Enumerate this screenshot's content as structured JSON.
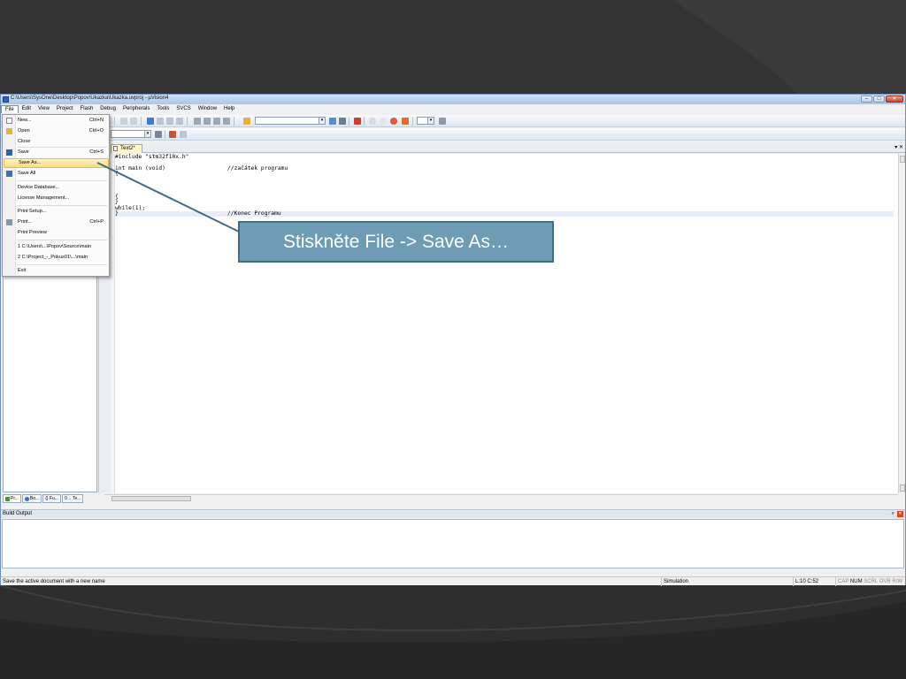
{
  "window": {
    "title": "C:\\Users\\SysOne\\Desktop\\Popov\\Ukazka\\Ukazka.uvproj - µVision4",
    "min_glyph": "–",
    "max_glyph": "□",
    "close_glyph": "✕"
  },
  "menubar": {
    "items": [
      "File",
      "Edit",
      "View",
      "Project",
      "Flash",
      "Debug",
      "Peripherals",
      "Tools",
      "SVCS",
      "Window",
      "Help"
    ]
  },
  "file_menu": {
    "items": [
      {
        "label": "New...",
        "shortcut": "Ctrl+N"
      },
      {
        "label": "Open",
        "shortcut": "Ctrl+O"
      },
      {
        "label": "Close",
        "shortcut": ""
      },
      {
        "label": "Save",
        "shortcut": "Ctrl+S"
      },
      {
        "label": "Save As...",
        "shortcut": ""
      },
      {
        "label": "Save All",
        "shortcut": ""
      },
      {
        "label": "Device Database...",
        "shortcut": ""
      },
      {
        "label": "License Management...",
        "shortcut": ""
      },
      {
        "label": "Print Setup...",
        "shortcut": ""
      },
      {
        "label": "Print...",
        "shortcut": "Ctrl+P"
      },
      {
        "label": "Print Preview",
        "shortcut": ""
      },
      {
        "label": "1 C:\\Users\\...\\Popov\\Source\\main",
        "shortcut": ""
      },
      {
        "label": "2 C:\\Project_-_Pokus01\\...\\main",
        "shortcut": ""
      },
      {
        "label": "Exit",
        "shortcut": ""
      }
    ]
  },
  "editor": {
    "tab_label": "Text2*",
    "tabstrip_controls": "▾ ✕",
    "lines": [
      {
        "code": "#include \"stm32f10x.h\"",
        "comment": ""
      },
      {
        "code": "",
        "comment": ""
      },
      {
        "code": "int main (void)",
        "comment": "//začátek programu"
      },
      {
        "code": "{",
        "comment": ""
      },
      {
        "code": "",
        "comment": ""
      },
      {
        "code": "",
        "comment": ""
      },
      {
        "code": "",
        "comment": ""
      },
      {
        "code": "{",
        "comment": ""
      },
      {
        "code": "}",
        "comment": ""
      },
      {
        "code": "while(1);",
        "comment": ""
      },
      {
        "code": "}",
        "comment": "//Konec Programu"
      }
    ]
  },
  "left_tabs": [
    "Pr...",
    "Bo...",
    "{} Fu...",
    "0→ Te..."
  ],
  "build_output": {
    "title": "Build Output",
    "pin": "⌕",
    "close": "✕"
  },
  "statusbar": {
    "message": "Save the active document with a new name",
    "mode": "Simulation",
    "position": "L:10 C:52",
    "cap": "CAP",
    "num": "NUM",
    "scrl": "SCRL",
    "ovr": "OVR",
    "rw": "R/W"
  },
  "callout": {
    "text": "Stiskněte File -> Save As…"
  },
  "colors": {
    "callout_fill": "#6e9cb4",
    "callout_border": "#3e6d87",
    "slide_background": "#2b2b2b",
    "menu_highlight": "#f8dc7c"
  }
}
